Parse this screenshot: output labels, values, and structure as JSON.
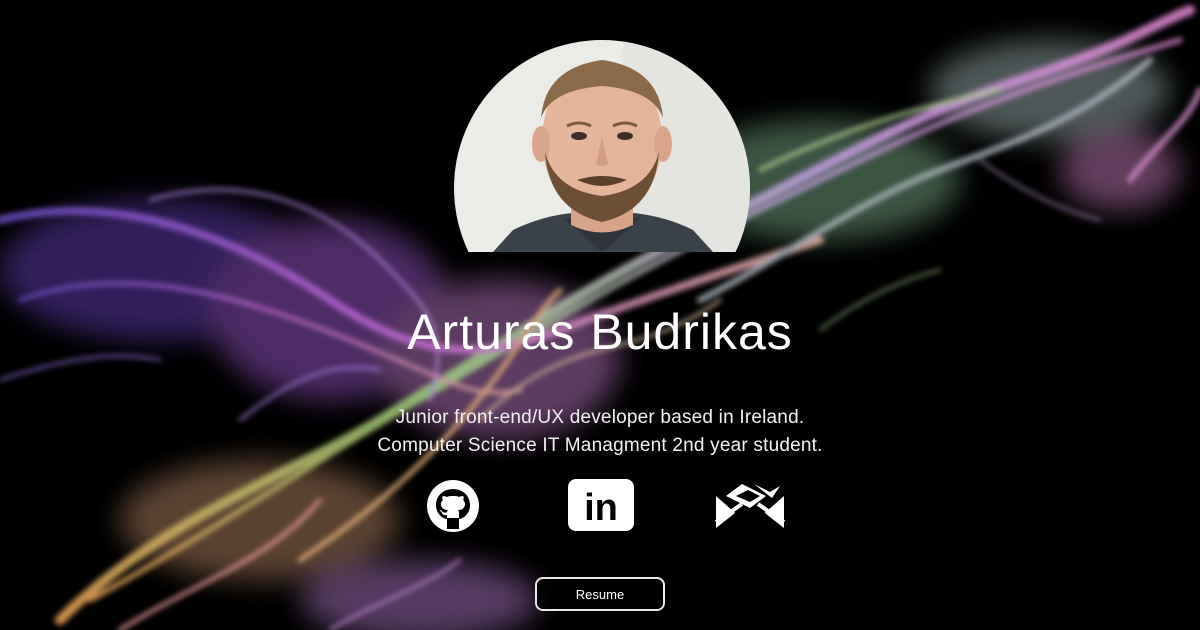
{
  "hero": {
    "name": "Arturas Budrikas",
    "bio_line1": "Junior front-end/UX developer based in Ireland.",
    "bio_line2": "Computer Science IT Managment 2nd year student."
  },
  "social": [
    {
      "icon": "github-icon"
    },
    {
      "icon": "linkedin-icon",
      "glyph": "in"
    },
    {
      "icon": "mail-icon"
    }
  ],
  "resume": {
    "label": "Resume"
  },
  "colors": {
    "background": "#000000",
    "text": "#ffffff",
    "smoke_purple": "#8b5cf6",
    "smoke_green": "#9ad07a",
    "smoke_orange": "#f2a65a",
    "smoke_pink": "#e58ad6"
  }
}
